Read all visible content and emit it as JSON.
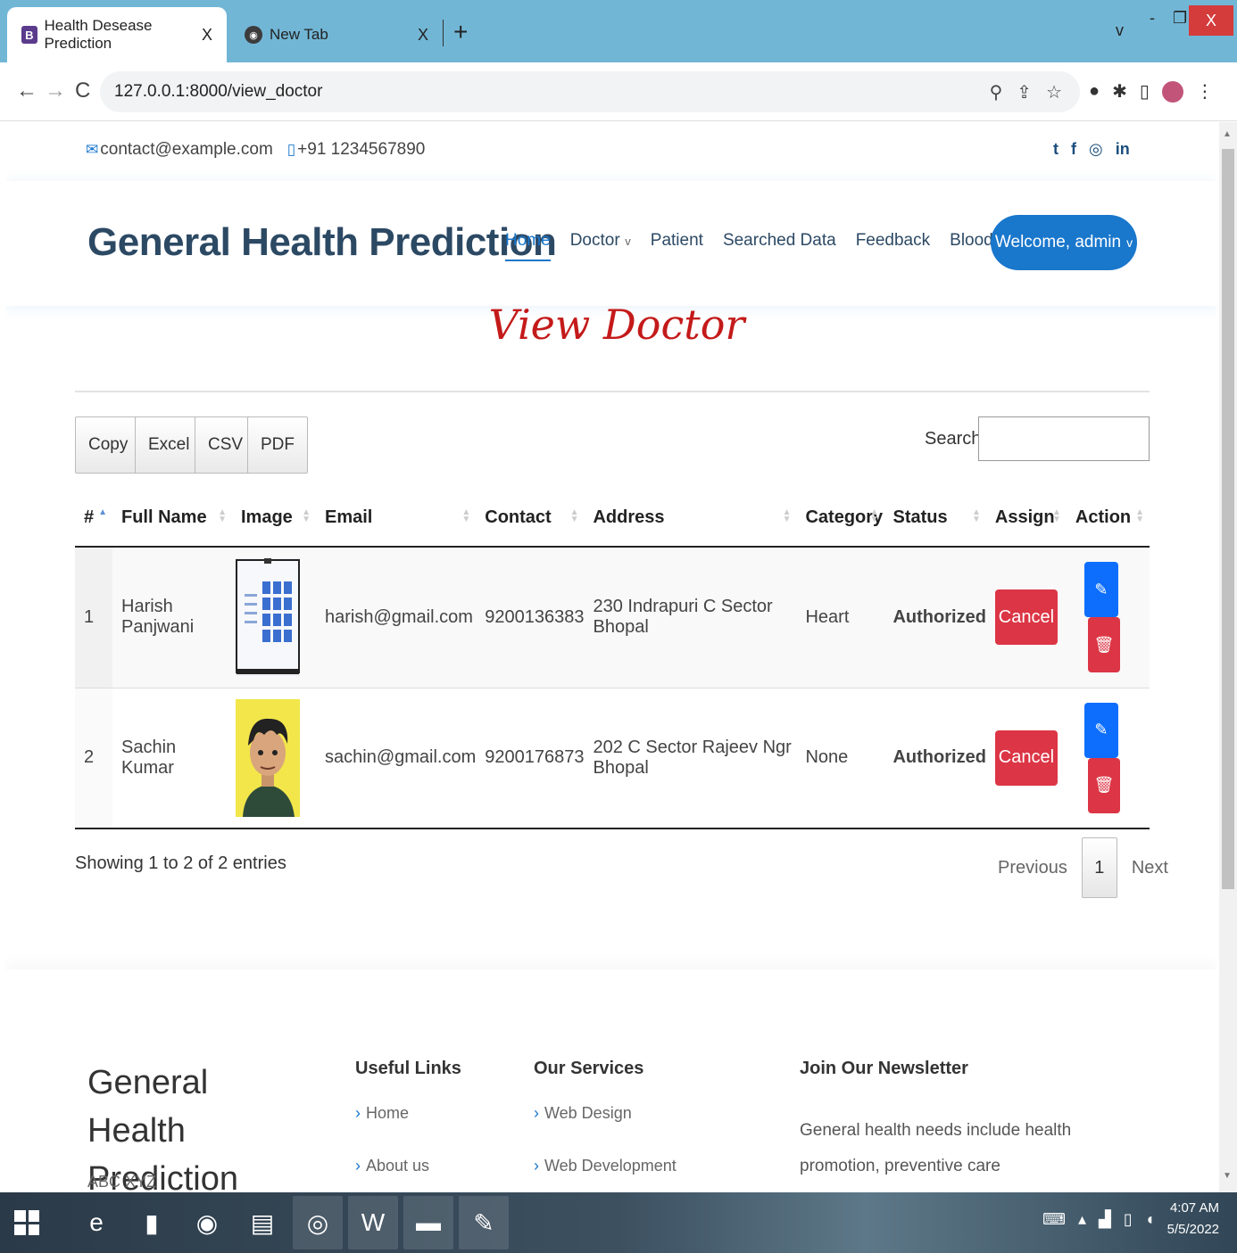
{
  "browser": {
    "tabs": [
      {
        "title": "Health Desease Prediction",
        "favicon": "B"
      },
      {
        "title": "New Tab",
        "favicon": "◉"
      }
    ],
    "url": "127.0.0.1:8000/view_doctor"
  },
  "topbar": {
    "email": "contact@example.com",
    "phone": "+91 1234567890",
    "socials": [
      "twitter-icon",
      "facebook-icon",
      "instagram-icon",
      "linkedin-icon"
    ]
  },
  "header": {
    "brand": "General Health Prediction",
    "menu": [
      {
        "label": "Home",
        "active": true,
        "dropdown": false
      },
      {
        "label": "Doctor",
        "active": false,
        "dropdown": true
      },
      {
        "label": "Patient",
        "active": false,
        "dropdown": false
      },
      {
        "label": "Searched Data",
        "active": false,
        "dropdown": false
      },
      {
        "label": "Feedback",
        "active": false,
        "dropdown": false
      },
      {
        "label": "Blood Donation",
        "active": false,
        "dropdown": true
      }
    ],
    "welcome": "Welcome, admin"
  },
  "page": {
    "title": "View Doctor"
  },
  "datatable": {
    "buttons": [
      "Copy",
      "Excel",
      "CSV",
      "PDF"
    ],
    "search_label": "Search:",
    "columns": [
      "#",
      "Full Name",
      "Image",
      "Email",
      "Contact",
      "Address",
      "Category",
      "Status",
      "Assign",
      "Action"
    ],
    "rows": [
      {
        "num": "1",
        "name": "Harish Panjwani",
        "image": "doctor-photo-1",
        "email": "harish@gmail.com",
        "contact": "9200136383",
        "address": "230 Indrapuri C Sector Bhopal",
        "category": "Heart",
        "status": "Authorized",
        "assign": "Cancel"
      },
      {
        "num": "2",
        "name": "Sachin Kumar",
        "image": "doctor-photo-2",
        "email": "sachin@gmail.com",
        "contact": "9200176873",
        "address": "202 C Sector Rajeev Ngr Bhopal",
        "category": "None",
        "status": "Authorized",
        "assign": "Cancel"
      }
    ],
    "info": "Showing 1 to 2 of 2 entries",
    "pager": {
      "previous": "Previous",
      "current": "1",
      "next": "Next"
    }
  },
  "footer": {
    "brand": "General Health Prediction",
    "address": "ABC XYZ",
    "useful_links": {
      "title": "Useful Links",
      "items": [
        "Home",
        "About us"
      ]
    },
    "services": {
      "title": "Our Services",
      "items": [
        "Web Design",
        "Web Development"
      ]
    },
    "newsletter": {
      "title": "Join Our Newsletter",
      "text": "General health needs include health promotion, preventive care (immunization, general health"
    }
  },
  "taskbar": {
    "time": "4:07 AM",
    "date": "5/5/2022"
  },
  "colors": {
    "accent": "#1977cc",
    "title_red": "#c41a1a",
    "danger": "#dc3545",
    "primary": "#0d6efd"
  }
}
